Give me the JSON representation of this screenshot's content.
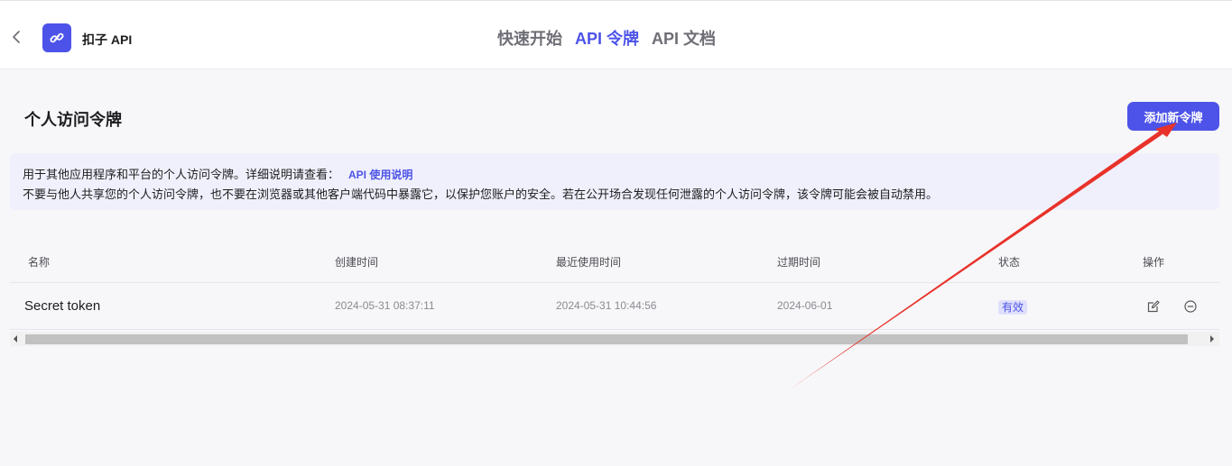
{
  "header": {
    "app_title": "扣子 API",
    "tabs": [
      {
        "label": "快速开始",
        "active": false
      },
      {
        "label": "API 令牌",
        "active": true
      },
      {
        "label": "API 文档",
        "active": false
      }
    ]
  },
  "page": {
    "title": "个人访问令牌",
    "add_button_label": "添加新令牌"
  },
  "notice": {
    "line1": "用于其他应用程序和平台的个人访问令牌。详细说明请查看：",
    "link": "API 使用说明",
    "line2": "不要与他人共享您的个人访问令牌，也不要在浏览器或其他客户端代码中暴露它，以保护您账户的安全。若在公开场合发现任何泄露的个人访问令牌，该令牌可能会被自动禁用。"
  },
  "table": {
    "columns": [
      "名称",
      "创建时间",
      "最近使用时间",
      "过期时间",
      "状态",
      "操作"
    ],
    "rows": [
      {
        "name": "Secret token",
        "created": "2024-05-31 08:37:11",
        "last_used": "2024-05-31 10:44:56",
        "expires": "2024-06-01",
        "status": "有效"
      }
    ]
  },
  "colors": {
    "accent": "#4d53e8",
    "annotation_arrow": "#e8322a"
  },
  "icons": [
    "back-chevron-icon",
    "link-icon",
    "edit-icon",
    "remove-circle-icon"
  ]
}
